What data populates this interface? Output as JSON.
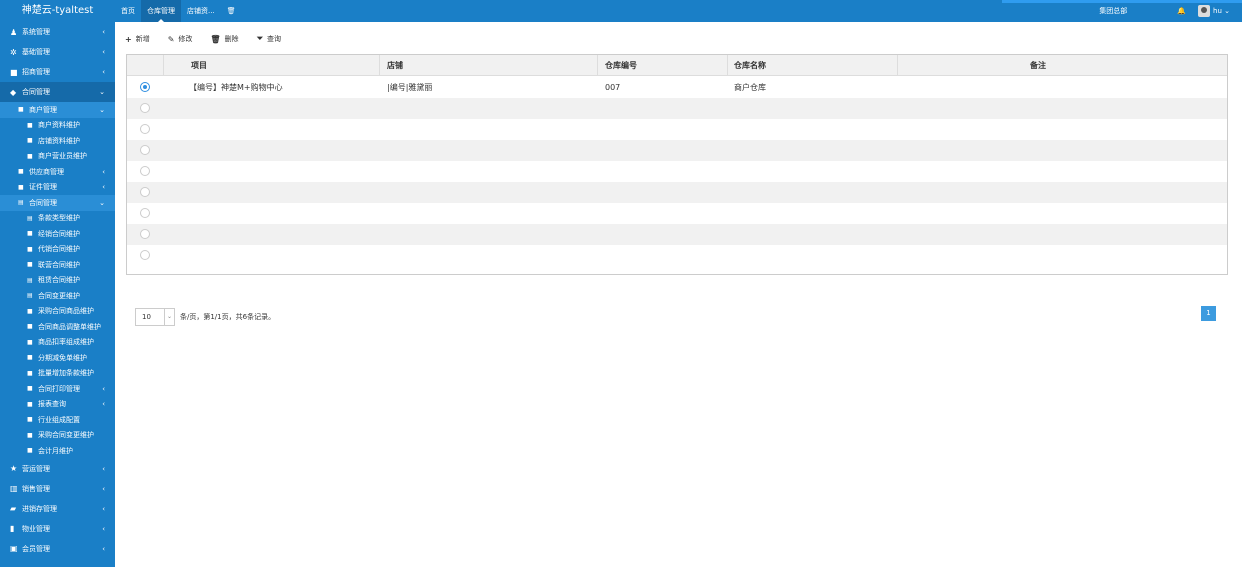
{
  "app": {
    "title": "神楚云-tyaltest"
  },
  "header": {
    "tabs": [
      {
        "label": "首页"
      },
      {
        "label": "仓库管理"
      },
      {
        "label": "店铺资..."
      }
    ],
    "extra_tab_icon": "trash-icon",
    "org": "集团总部",
    "user": "hu",
    "colors": {
      "bar": "#1a7fc7",
      "accent": "#2f9cf0"
    }
  },
  "sidebar": {
    "items": [
      {
        "label": "系统管理",
        "icon": "user-icon"
      },
      {
        "label": "基础管理",
        "icon": "gear-icon"
      },
      {
        "label": "招商管理",
        "icon": "book-icon"
      },
      {
        "label": "合同管理",
        "icon": "tag-icon"
      }
    ],
    "sub_header": {
      "label": "商户管理"
    },
    "sub_items": [
      {
        "label": "商户资料维护"
      },
      {
        "label": "店铺资料维护"
      },
      {
        "label": "商户营业员维护"
      }
    ],
    "groups": [
      {
        "label": "供应商管理"
      },
      {
        "label": "证件管理"
      },
      {
        "label": "合同管理"
      }
    ],
    "contract_items": [
      {
        "label": "条款类型维护"
      },
      {
        "label": "经销合同维护"
      },
      {
        "label": "代销合同维护"
      },
      {
        "label": "联营合同维护"
      },
      {
        "label": "租赁合同维护"
      },
      {
        "label": "合同变更维护"
      },
      {
        "label": "采购合同商品维护"
      },
      {
        "label": "合同商品调整单维护"
      },
      {
        "label": "商品扣率组成维护"
      },
      {
        "label": "分期减免单维护"
      },
      {
        "label": "批量增加条款维护"
      },
      {
        "label": "合同打印管理"
      },
      {
        "label": "报表查询"
      },
      {
        "label": "行业组成配置"
      },
      {
        "label": "采购合同变更维护"
      },
      {
        "label": "会计月维护"
      }
    ],
    "bottom_items": [
      {
        "label": "营运管理",
        "icon": "star-icon"
      },
      {
        "label": "销售管理",
        "icon": "chart-icon"
      },
      {
        "label": "进销存管理",
        "icon": "car-icon"
      },
      {
        "label": "物业管理",
        "icon": "briefcase-icon"
      },
      {
        "label": "会员管理",
        "icon": "vip-icon"
      }
    ]
  },
  "toolbar": {
    "add": "新增",
    "edit": "修改",
    "delete": "删除",
    "query": "查询"
  },
  "table": {
    "columns": [
      "项目",
      "店铺",
      "仓库编号",
      "仓库名称",
      "备注"
    ],
    "rows": [
      {
        "project": "【编号】神楚M+购物中心",
        "shop": "|编号|雅黛丽",
        "code": "007",
        "name": "商户仓库",
        "note": "",
        "selected": true
      }
    ]
  },
  "pagination": {
    "page_size": "10",
    "summary": "条/页，第1/1页，共6条记录。",
    "current_page": "1"
  }
}
